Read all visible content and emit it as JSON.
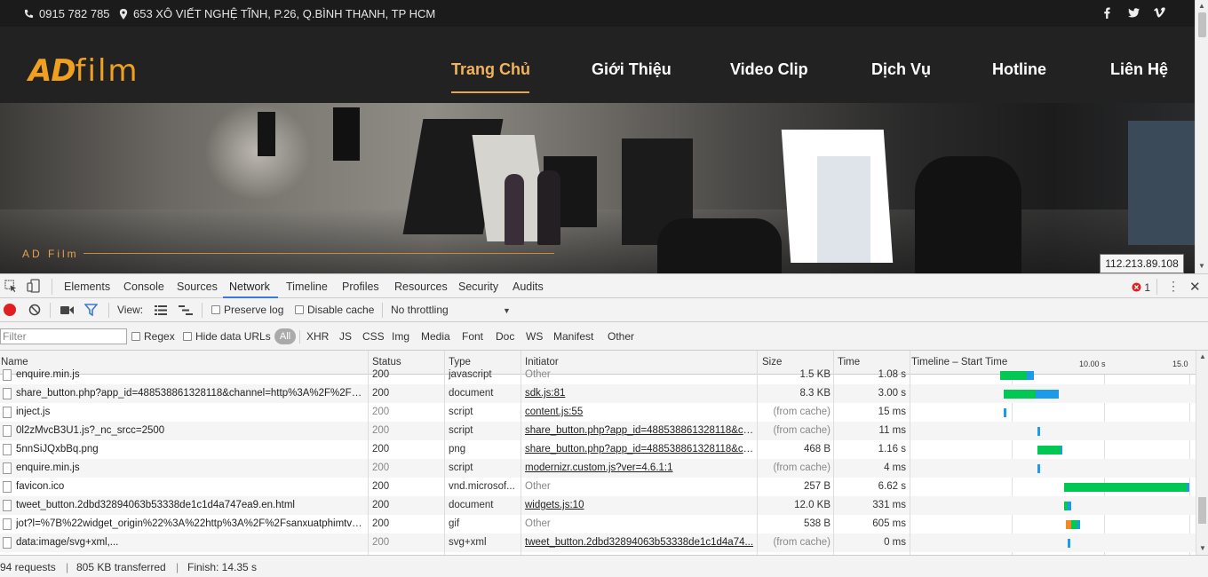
{
  "site": {
    "phone": "0915 782 785",
    "address": "653 XÔ VIẾT NGHỆ TĨNH, P.26, Q.BÌNH THẠNH, TP HCM",
    "logo_bold": "AD",
    "logo_light": "film",
    "nav": [
      "Trang Chủ",
      "Giới Thiệu",
      "Video Clip",
      "Dịch Vụ",
      "Hotline",
      "Liên Hệ"
    ],
    "hero_caption": "AD Film",
    "ip_tooltip": "112.213.89.108",
    "social_icons": [
      "facebook-icon",
      "twitter-icon",
      "vimeo-icon"
    ],
    "accent": "#f0a020"
  },
  "devtools": {
    "tabs": [
      "Elements",
      "Console",
      "Sources",
      "Network",
      "Timeline",
      "Profiles",
      "Resources",
      "Security",
      "Audits"
    ],
    "active_tab": "Network",
    "error_count": "1",
    "toolbar": {
      "view_label": "View:",
      "preserve_log": "Preserve log",
      "disable_cache": "Disable cache",
      "throttling": "No throttling"
    },
    "filterbar": {
      "placeholder": "Filter",
      "regex": "Regex",
      "hide_data_urls": "Hide data URLs",
      "all": "All",
      "types": [
        "XHR",
        "JS",
        "CSS",
        "Img",
        "Media",
        "Font",
        "Doc",
        "WS",
        "Manifest",
        "Other"
      ]
    },
    "columns": {
      "name": "Name",
      "status": "Status",
      "type": "Type",
      "initiator": "Initiator",
      "size": "Size",
      "time": "Time",
      "timeline": "Timeline – Start Time",
      "tick1": "10.00 s",
      "tick2": "15.0"
    },
    "rows": [
      {
        "name": "enquire.min.js",
        "status": "200",
        "type": "javascript",
        "initiator": "Other",
        "size": "1.5 KB",
        "time": "1.08 s"
      },
      {
        "name": "share_button.php?app_id=488538861328118&channel=http%3A%2F%2Fsta...",
        "status": "200",
        "type": "document",
        "initiator": "sdk.js:81",
        "size": "8.3 KB",
        "time": "3.00 s"
      },
      {
        "name": "inject.js",
        "status": "200",
        "type": "script",
        "initiator": "content.js:55",
        "size": "(from cache)",
        "time": "15 ms"
      },
      {
        "name": "0l2zMvcB3U1.js?_nc_srcc=2500",
        "status": "200",
        "type": "script",
        "initiator": "share_button.php?app_id=488538861328118&ch...",
        "size": "(from cache)",
        "time": "11 ms"
      },
      {
        "name": "5nnSiJQxbBq.png",
        "status": "200",
        "type": "png",
        "initiator": "share_button.php?app_id=488538861328118&ch...",
        "size": "468 B",
        "time": "1.16 s"
      },
      {
        "name": "enquire.min.js",
        "status": "200",
        "type": "script",
        "initiator": "modernizr.custom.js?ver=4.6.1:1",
        "size": "(from cache)",
        "time": "4 ms"
      },
      {
        "name": "favicon.ico",
        "status": "200",
        "type": "vnd.microsof...",
        "initiator": "Other",
        "size": "257 B",
        "time": "6.62 s"
      },
      {
        "name": "tweet_button.2dbd32894063b53338de1c1d4a747ea9.en.html",
        "status": "200",
        "type": "document",
        "initiator": "widgets.js:10",
        "size": "12.0 KB",
        "time": "331 ms"
      },
      {
        "name": "jot?l=%7B%22widget_origin%22%3A%22http%3A%2F%2Fsanxuatphimtvcq...",
        "status": "200",
        "type": "gif",
        "initiator": "Other",
        "size": "538 B",
        "time": "605 ms"
      },
      {
        "name": "data:image/svg+xml,...",
        "status": "200",
        "type": "svg+xml",
        "initiator": "tweet_button.2dbd32894063b53338de1c1d4a74...",
        "size": "(from cache)",
        "time": "0 ms"
      }
    ],
    "status": {
      "requests": "94 requests",
      "transferred": "805 KB transferred",
      "finish": "Finish: 14.35 s"
    },
    "colors": {
      "waiting": "#00c853",
      "download": "#1e9be8",
      "record": "#e02020"
    }
  }
}
